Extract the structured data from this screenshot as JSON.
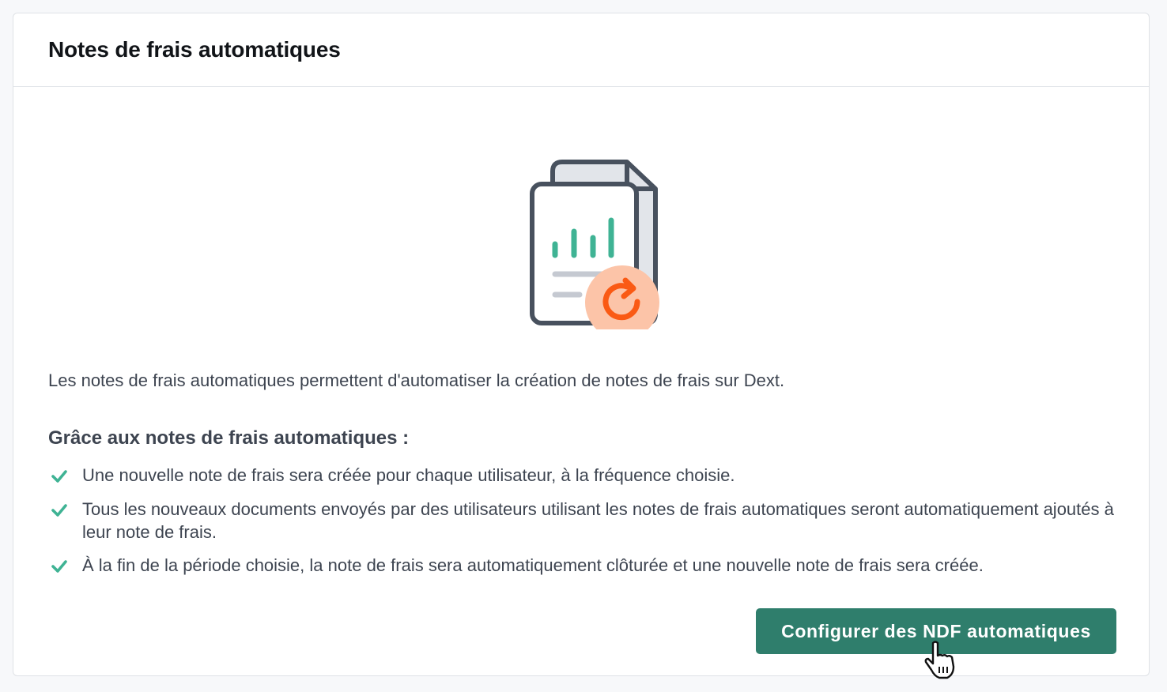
{
  "header": {
    "title": "Notes de frais automatiques"
  },
  "illustration": {
    "icon": "expense-report-refresh-illustration",
    "colors": {
      "outline": "#48515e",
      "bars": "#3fb394",
      "lines": "#c5c9d1",
      "badge": "#fcc4a8",
      "arrow": "#fa5a14"
    }
  },
  "content": {
    "description": "Les notes de frais automatiques permettent d'automatiser la création de notes de frais sur Dext.",
    "benefits_title": "Grâce aux notes de frais automatiques :",
    "benefits": [
      {
        "text": "Une nouvelle note de frais sera créée pour chaque utilisateur, à la fréquence choisie.",
        "icon": "check-icon"
      },
      {
        "text": "Tous les nouveaux documents envoyés par des utilisateurs utilisant les notes de frais automatiques seront automatiquement ajoutés à leur note de frais.",
        "icon": "check-icon"
      },
      {
        "text": "À la fin de la période choisie, la note de frais sera automatiquement clôturée et une nouvelle note de frais sera créée.",
        "icon": "check-icon"
      }
    ]
  },
  "actions": {
    "configure_label": "Configurer des NDF automatiques"
  },
  "colors": {
    "accent": "#2f7e6c",
    "check": "#3fb394",
    "text": "#3d4450"
  }
}
